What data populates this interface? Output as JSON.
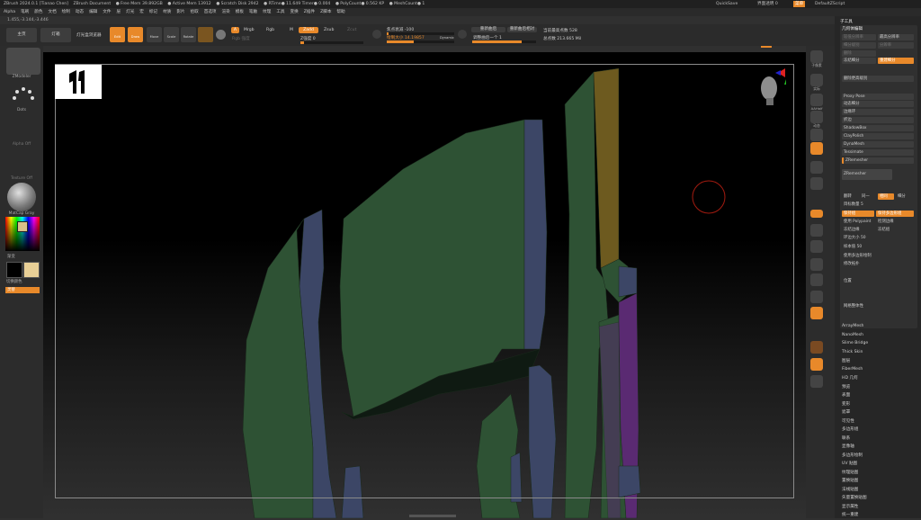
{
  "titlebar": {
    "items": [
      "ZBrush 2024.0.1 [Tianao Chen]",
      "ZBrush Document",
      "● Free Mem 39.892GB",
      "● Active Mem 13912",
      "● Scratch Disk 2942",
      "● RTime● 11.649 Timer● 0.004",
      "● PolyCount● 0.562 KP",
      "● MeshCount● 1"
    ],
    "quicksave": "QuickSave",
    "transparency": "界面透明 0",
    "menus_label": "菜单",
    "script": "DefaultZScript"
  },
  "menubar": [
    "Alpha",
    "笔刷",
    "颜色",
    "文档",
    "绘制",
    "动态",
    "编辑",
    "文件",
    "层",
    "灯光",
    "宏",
    "标记",
    "材质",
    "影片",
    "拾取",
    "首选项",
    "渲染",
    "模板",
    "笔触",
    "纹理",
    "工具",
    "变换",
    "Z插件",
    "Z脚本",
    "帮助"
  ],
  "coords": "1.455,-3.144,-3.446",
  "toolbar": {
    "home": "主页",
    "lightbox": "灯箱",
    "lightbox_browser": "灯光盒浏览器",
    "edit": "Edit",
    "draw": "Draw",
    "move": "Move",
    "scale": "Scale",
    "rotate": "Rotate",
    "a": "A",
    "mrgb": "Mrgb",
    "rgb": "Rgb",
    "m": "M",
    "zadd": "Zadd",
    "zsub": "Zsub",
    "zcut": "Zcut",
    "rgb_intensity": "Rgb 强度",
    "z_intensity": "Z强度 0",
    "focal_shift": "焦点衰减 -100",
    "draw_size": "绘制大小 14.19857",
    "dynamic": "Dynamic",
    "fill_ratio": "重新曲后",
    "resample_last": "调整曲后一个 1",
    "resample_related": "重新曲后相对",
    "poly_count": "当前最高点数 528",
    "total_points": "总点数 213.665 Mil"
  },
  "leftpanel": {
    "brush": "ZModeler",
    "stroke": "Dots",
    "alpha": "Alpha Off",
    "texture": "Texture Off",
    "material": "MatCap Gray",
    "color_label": "渐变",
    "switch": "切换颜色",
    "alt": "灵替"
  },
  "rightstrip": [
    "子像素",
    "实际",
    "AAHalf",
    "动态",
    "透视",
    "地面",
    "网格",
    "局部",
    "对称",
    "框架",
    "移动",
    "缩放",
    "旋转",
    "PolyF",
    "透明",
    "单独"
  ],
  "rightpanel": {
    "title": "子工具",
    "header": "几何体编辑",
    "rows": [
      "较低分辨率",
      "最高分辨率",
      "细分级别",
      "分辨率",
      "删除",
      "冻结细分",
      "重建细分",
      "删除更高级别",
      "Proxy Pose",
      "动态细分",
      "边缘环",
      "折边",
      "ShadowBox",
      "ClayPolish",
      "DynaMesh",
      "Tessimate",
      "ZRemesher",
      "修改拓扑",
      "位置",
      "网格整体性"
    ],
    "zremesher": "ZRemesher",
    "flip": "翻转",
    "same": "同一",
    "adaptive": "相同",
    "subdivide": "细分",
    "target": "目标数量 5",
    "half": "半数",
    "crease": "折边",
    "keep_groups": "保持组",
    "keep_creases": "保持多边形组",
    "use_polypaint": "使用 Polypaint",
    "detect_edges": "检测边缘",
    "freeze_border": "冻结边缘",
    "freeze_groups": "冻结组",
    "loop_size": "环边大小 50",
    "sample": "样本值 50",
    "symmetry_label": "使用多边形绘制",
    "lower_edges": "修改拓扑",
    "list": [
      "ArrayMesh",
      "NanoMesh",
      "Slime Bridge",
      "Thick Skin",
      "图层",
      "FiberMesh",
      "HD 几何",
      "预览",
      "表面",
      "变形",
      "遮罩",
      "可见性",
      "多边形组",
      "联系",
      "显像轴",
      "多边形绘制",
      "UV 贴图",
      "纹理贴图",
      "置换贴图",
      "法线贴图",
      "矢量置换贴图",
      "显示属性",
      "统一重建"
    ]
  },
  "colors": {
    "accent": "#e8892a",
    "mesh_green": "#2e5234",
    "mesh_blue": "#3c4666",
    "mesh_gold": "#6d5a1f",
    "mesh_purple": "#5a2a72"
  }
}
